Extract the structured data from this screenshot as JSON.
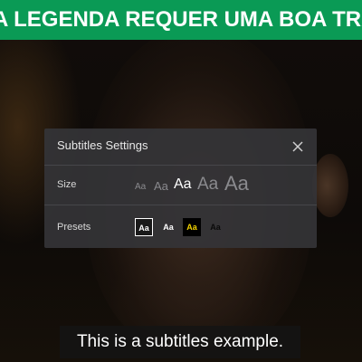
{
  "banner": {
    "text": "A LEGENDA REQUER UMA BOA TRA"
  },
  "panel": {
    "title": "Subtitles Settings",
    "close_icon": "close-icon",
    "size_label": "Size",
    "presets_label": "Presets",
    "size_options": [
      "Aa",
      "Aa",
      "Aa",
      "Aa",
      "Aa"
    ],
    "selected_size_index": 2,
    "presets": [
      "Aa",
      "Aa",
      "Aa",
      "Aa"
    ],
    "selected_preset_index": 0
  },
  "subtitle": {
    "text": "This is a subtitles example."
  },
  "colors": {
    "banner": "#0a9a55",
    "panel": "#343437",
    "preset_yellow_text": "#f2d200",
    "preset_selected_border": "#ffffff"
  }
}
